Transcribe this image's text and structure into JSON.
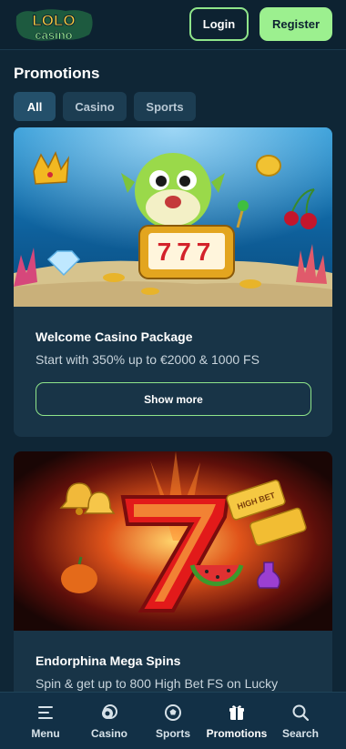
{
  "header": {
    "logo_top": "LOLO",
    "logo_bottom": "casino",
    "login_label": "Login",
    "register_label": "Register"
  },
  "promotions": {
    "title": "Promotions",
    "tabs": [
      {
        "label": "All",
        "active": true
      },
      {
        "label": "Casino",
        "active": false
      },
      {
        "label": "Sports",
        "active": false
      }
    ],
    "cards": [
      {
        "title": "Welcome Casino Package",
        "description": "Start with 350% up to €2000 & 1000 FS",
        "button_label": "Show more",
        "image_slot_text": "777"
      },
      {
        "title": "Endorphina Mega Spins",
        "description": "Spin & get up to 800 High Bet FS on Lucky",
        "ticket_text": "HIGH BET"
      }
    ]
  },
  "bottom_nav": {
    "items": [
      {
        "label": "Menu",
        "icon": "menu-icon"
      },
      {
        "label": "Casino",
        "icon": "casino-chip-icon"
      },
      {
        "label": "Sports",
        "icon": "soccer-ball-icon"
      },
      {
        "label": "Promotions",
        "icon": "gift-icon",
        "active": true
      },
      {
        "label": "Search",
        "icon": "search-icon"
      }
    ]
  },
  "colors": {
    "background": "#0f2636",
    "card": "#183447",
    "accent_green": "#9cf08f",
    "tab_bg": "#1c3d52"
  }
}
